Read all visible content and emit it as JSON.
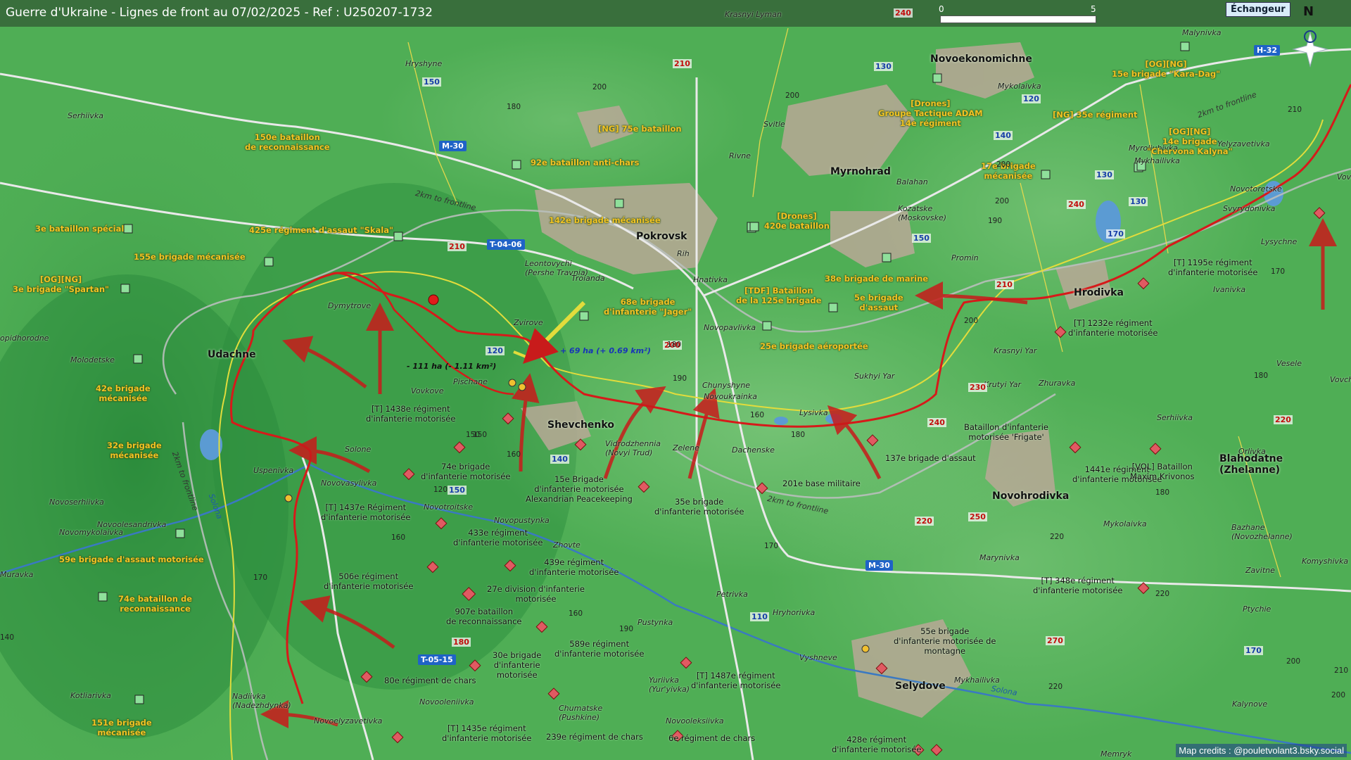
{
  "title": "Guerre d'Ukraine - Lignes de front au 07/02/2025 - Ref : U250207-1732",
  "credits": "Map credits : @pouletvolant3.bsky.social",
  "echangeur": "Échangeur",
  "north": "N",
  "scale": {
    "start": "0",
    "mid": "5"
  },
  "towns_bold": [
    {
      "t": "Pokrovsk"
    },
    {
      "t": "Myrnohrad"
    },
    {
      "t": "Udachne"
    },
    {
      "t": "Shevchenko"
    },
    {
      "t": "Novoekonomichne"
    },
    {
      "t": "Hrodivka"
    },
    {
      "t": "Novohrodivka"
    },
    {
      "t": "Selydove"
    },
    {
      "t": "Blahodatne\n(Zhelanne)"
    }
  ],
  "towns": [
    {
      "t": "Krasnyi Lyman"
    },
    {
      "t": "Hryshyne"
    },
    {
      "t": "Serhiivka"
    },
    {
      "t": "Svitle"
    },
    {
      "t": "Rivne"
    },
    {
      "t": "Mykolaivka"
    },
    {
      "t": "Malynivka"
    },
    {
      "t": "Myroliubivka"
    },
    {
      "t": "Mykhailivka"
    },
    {
      "t": "Yelyzavetivka"
    },
    {
      "t": "Novotoretske"
    },
    {
      "t": "Svyrydonivka"
    },
    {
      "t": "Lysychne"
    },
    {
      "t": "Balahan"
    },
    {
      "t": "Kozatske\n(Moskovske)"
    },
    {
      "t": "Promin"
    },
    {
      "t": "Ivanivka"
    },
    {
      "t": "Leontovychi\n(Pershe Travnia)"
    },
    {
      "t": "Troianda"
    },
    {
      "t": "Rih"
    },
    {
      "t": "Hnativka"
    },
    {
      "t": "Novopavlivka"
    },
    {
      "t": "Dymytrove"
    },
    {
      "t": "Zvirove"
    },
    {
      "t": "Molodetske"
    },
    {
      "t": "Vovkove"
    },
    {
      "t": "Pischane"
    },
    {
      "t": "Chunyshyne"
    },
    {
      "t": "Novoukrainka"
    },
    {
      "t": "Sukhyi Yar"
    },
    {
      "t": "Krasnyi Yar"
    },
    {
      "t": "Krutyi Yar"
    },
    {
      "t": "Zhuravka"
    },
    {
      "t": "Vesele"
    },
    {
      "t": "Lysivka"
    },
    {
      "t": "Vidrodzhennia\n(Novyi Trud)"
    },
    {
      "t": "Zelene"
    },
    {
      "t": "Dachenske"
    },
    {
      "t": "Serhiivka"
    },
    {
      "t": "Orlivka"
    },
    {
      "t": "Solone"
    },
    {
      "t": "Novoserhiivka"
    },
    {
      "t": "Uspenivka"
    },
    {
      "t": "Novovasylivka"
    },
    {
      "t": "Novotroitske"
    },
    {
      "t": "Novoolesandrivka"
    },
    {
      "t": "Novomykolaivka"
    },
    {
      "t": "Novopustynka"
    },
    {
      "t": "Zhovte"
    },
    {
      "t": "Muravka"
    },
    {
      "t": "Kotliarivka"
    },
    {
      "t": "Nadiivka\n(Nadezhdynka)"
    },
    {
      "t": "Novoelyzavetivka"
    },
    {
      "t": "Novooleniivka"
    },
    {
      "t": "Chumatske\n(Pushkine)"
    },
    {
      "t": "Pustynka"
    },
    {
      "t": "Yuriivka\n(Yur'yivka)"
    },
    {
      "t": "Novooleksiivka"
    },
    {
      "t": "Petrivka"
    },
    {
      "t": "Hryhorivka"
    },
    {
      "t": "Vyshneve"
    },
    {
      "t": "Mykhailivka"
    },
    {
      "t": "Marynivka"
    },
    {
      "t": "Mykolaivka"
    },
    {
      "t": "Bazhane\n(Novozhelanne)"
    },
    {
      "t": "Zavitne"
    },
    {
      "t": "Komyshivka"
    },
    {
      "t": "Ptychie"
    },
    {
      "t": "Kalynove"
    },
    {
      "t": "Memryk"
    },
    {
      "t": "Vovcha"
    },
    {
      "t": "Vovchenka"
    },
    {
      "t": "opidhorodne"
    }
  ],
  "ua_units": [
    {
      "t": "150e bataillon\nde reconnaissance"
    },
    {
      "t": "92e bataillon anti-chars"
    },
    {
      "t": "[NG] 75e bataillon"
    },
    {
      "t": "3e bataillon spécial"
    },
    {
      "t": "425e régiment d'assaut \"Skala\""
    },
    {
      "t": "155e brigade mécanisée"
    },
    {
      "t": "[OG][NG]\n3e brigade \"Spartan\""
    },
    {
      "t": "142e brigade mécanisée"
    },
    {
      "t": "[Drones]\n420e bataillon"
    },
    {
      "t": "[Drones]\nGroupe Tactique ADAM\n14e régiment"
    },
    {
      "t": "[NG] 35e régiment"
    },
    {
      "t": "[OG][NG]\n15e brigade \"Kara-Dag\""
    },
    {
      "t": "[OG][NG]\n14e brigade\n\"Chervona Kalyna\""
    },
    {
      "t": "17e brigade\nmécanisée"
    },
    {
      "t": "68e brigade\nd'infanterie \"Jager\""
    },
    {
      "t": "[TDF] Bataillon\nde la 125e brigade"
    },
    {
      "t": "5e brigade\nd'assaut"
    },
    {
      "t": "38e brigade de marine"
    },
    {
      "t": "25e brigade aéroportée"
    },
    {
      "t": "42e brigade\nmécanisée"
    },
    {
      "t": "32e brigade\nmécanisée"
    },
    {
      "t": "59e brigade d'assaut motorisée"
    },
    {
      "t": "74e bataillon de\nreconnaissance"
    },
    {
      "t": "151e brigade\nmécanisée"
    }
  ],
  "ru_units": [
    {
      "t": "[T] 1438e régiment\nd'infanterie motorisée"
    },
    {
      "t": "74e brigade\nd'infanterie motorisée"
    },
    {
      "t": "[T] 1437e Régiment\nd'infanterie motorisée"
    },
    {
      "t": "15e Brigade\nd'infanterie motorisée\nAlexandrian Peacekeeping"
    },
    {
      "t": "35e brigade\nd'infanterie motorisée"
    },
    {
      "t": "201e base militaire"
    },
    {
      "t": "137e brigade d'assaut"
    },
    {
      "t": "433e régiment\nd'infanterie motorisée"
    },
    {
      "t": "439e régiment\nd'infanterie motorisée"
    },
    {
      "t": "506e régiment\nd'infanterie motorisée"
    },
    {
      "t": "27e division d'infanterie\nmotorisée"
    },
    {
      "t": "907e bataillon\nde reconnaissance"
    },
    {
      "t": "589e régiment\nd'infanterie motorisée"
    },
    {
      "t": "30e brigade\nd'infanterie\nmotorisée"
    },
    {
      "t": "80e régiment de chars"
    },
    {
      "t": "[T] 1487e régiment\nd'infanterie motorisée"
    },
    {
      "t": "[T] 1435e régiment\nd'infanterie motorisée"
    },
    {
      "t": "239e régiment de chars"
    },
    {
      "t": "6e régiment de chars"
    },
    {
      "t": "428e régiment\nd'infanterie motorisée"
    },
    {
      "t": "55e brigade\nd'infanterie motorisée de\nmontagne"
    },
    {
      "t": "[T] 1195e régiment\nd'infanterie motorisée"
    },
    {
      "t": "[T] 1232e régiment\nd'infanterie motorisée"
    },
    {
      "t": "Bataillon d'infanterie\nmotorisée 'Frigate'"
    },
    {
      "t": "1441e régiment\nd'infanterie motorisée"
    },
    {
      "t": "[VOL] Bataillon\nMaxim Krivonos"
    },
    {
      "t": "[T] 348e régiment\nd'infanterie motorisée"
    }
  ],
  "roads": [
    "M-30",
    "T-04-06",
    "T-05-15",
    "M-30",
    "H-32"
  ],
  "road_numbers_blue": [
    "150",
    "130",
    "120",
    "140",
    "130",
    "130",
    "170",
    "150",
    "120",
    "140",
    "150",
    "110",
    "170"
  ],
  "road_numbers_red": [
    "210",
    "240",
    "210",
    "240",
    "210",
    "200",
    "230",
    "240",
    "220",
    "250",
    "180",
    "270",
    "220"
  ],
  "heights": [
    "200",
    "180",
    "200",
    "180",
    "190",
    "150",
    "160",
    "120",
    "160",
    "170",
    "180",
    "190",
    "160",
    "200",
    "200",
    "210",
    "200",
    "170",
    "180",
    "180",
    "160",
    "170",
    "190",
    "220",
    "220",
    "210",
    "200",
    "200",
    "220",
    "140",
    "150"
  ],
  "area_changes": [
    "+ 69 ha (+ 0.69 km²)",
    "- 111 ha (- 1.11 km²)"
  ],
  "frontline_labels": [
    "2km to frontline",
    "2km to frontline",
    "2km to frontline",
    "2km to frontline"
  ],
  "rivers": [
    "Solona",
    "Solona"
  ],
  "colors": {
    "ukraine_units": "#f3c324",
    "russia_units": "#e05a62",
    "frontline": "#d61a1a",
    "gray_zone": "#e0d94a",
    "terrain": "#4fae55"
  }
}
